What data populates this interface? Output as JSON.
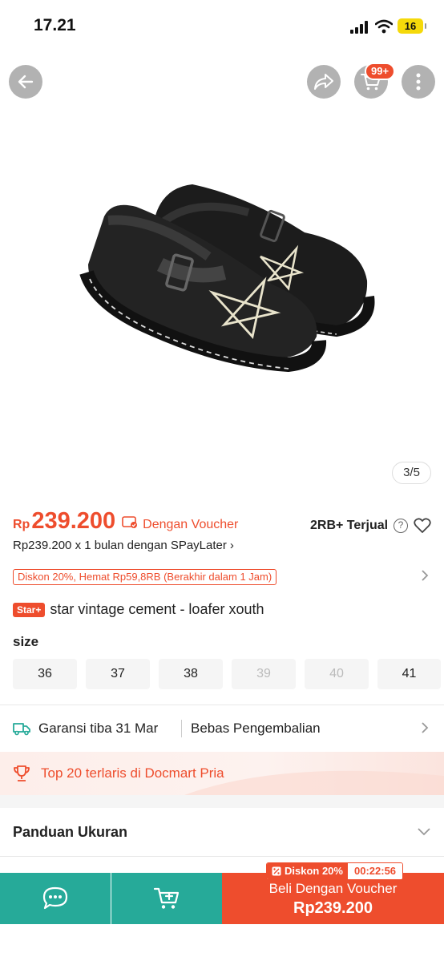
{
  "status_bar": {
    "time": "17.21",
    "battery": "16"
  },
  "nav": {
    "cart_badge": "99+"
  },
  "gallery": {
    "counter": "3/5"
  },
  "price": {
    "currency": "Rp",
    "value": "239.200",
    "voucher_label": "Dengan Voucher",
    "sold": "2RB+ Terjual",
    "help": "?",
    "paylater": "Rp239.200 x 1 bulan dengan SPayLater",
    "paylater_chevron": "›"
  },
  "discount": {
    "label": "Diskon 20%, Hemat Rp59,8RB (Berakhir dalam 1 Jam)"
  },
  "product": {
    "badge": "Star+",
    "title": "star vintage cement - loafer xouth"
  },
  "size": {
    "label": "size",
    "options": [
      {
        "label": "36",
        "available": true
      },
      {
        "label": "37",
        "available": true
      },
      {
        "label": "38",
        "available": true
      },
      {
        "label": "39",
        "available": false
      },
      {
        "label": "40",
        "available": false
      },
      {
        "label": "41",
        "available": true
      }
    ]
  },
  "shipping": {
    "guarantee": "Garansi tiba 31 Mar",
    "returns": "Bebas Pengembalian"
  },
  "banner": {
    "text": "Top 20 terlaris di Docmart Pria"
  },
  "size_guide": {
    "label": "Panduan Ukuran"
  },
  "bottom_bar": {
    "flash_label": "Diskon 20%",
    "flash_timer": "00:22:56",
    "buy_label": "Beli Dengan Voucher",
    "buy_price": "Rp239.200"
  },
  "colors": {
    "brand": "#ee4d2d",
    "teal": "#26aa99"
  },
  "icons": [
    "back-arrow-icon",
    "share-icon",
    "cart-icon",
    "more-icon",
    "voucher-icon",
    "help-icon",
    "heart-icon",
    "chevron-right-icon",
    "truck-icon",
    "trophy-icon",
    "chevron-down-icon",
    "chat-icon",
    "add-to-cart-icon",
    "discount-icon"
  ]
}
